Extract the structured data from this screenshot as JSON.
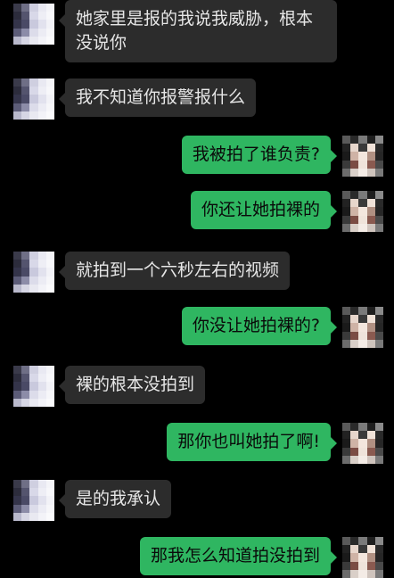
{
  "colors": {
    "background": "#000000",
    "received_bubble": "#2c2c2c",
    "sent_bubble": "#2fb661",
    "received_text": "#e6e6e6",
    "sent_text": "#0a0a0a"
  },
  "messages": [
    {
      "side": "left",
      "text": "她家里是报的我说我威胁，根本没说你",
      "avatar": "pixelated-avatar"
    },
    {
      "side": "left",
      "text": "我不知道你报警报什么",
      "avatar": "pixelated-avatar"
    },
    {
      "side": "right",
      "text": "我被拍了谁负责?",
      "avatar": "pixelated-avatar"
    },
    {
      "side": "right",
      "text": "你还让她拍裸的",
      "avatar": "pixelated-avatar"
    },
    {
      "side": "left",
      "text": "就拍到一个六秒左右的视频",
      "avatar": "pixelated-avatar"
    },
    {
      "side": "right",
      "text": "你没让她拍裸的?",
      "avatar": "pixelated-avatar"
    },
    {
      "side": "left",
      "text": "裸的根本没拍到",
      "avatar": "pixelated-avatar"
    },
    {
      "side": "right",
      "text": "那你也叫她拍了啊!",
      "avatar": "pixelated-avatar"
    },
    {
      "side": "left",
      "text": "是的我承认",
      "avatar": "pixelated-avatar"
    },
    {
      "side": "right",
      "text": "那我怎么知道拍没拍到",
      "avatar": "pixelated-avatar"
    }
  ]
}
